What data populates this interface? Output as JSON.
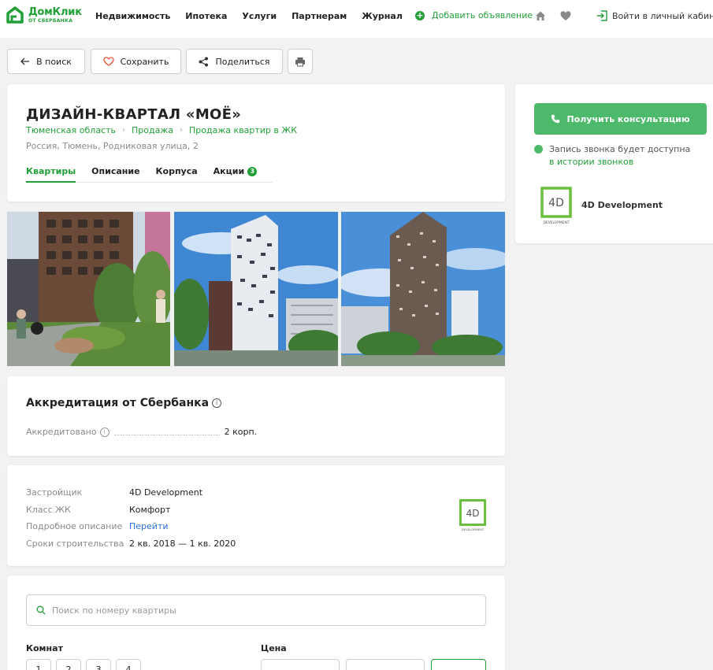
{
  "header": {
    "logo_title": "ДомКлик",
    "logo_sub": "ОТ СБЕРБАНКА",
    "nav": [
      "Недвижимость",
      "Ипотека",
      "Услуги",
      "Партнерам",
      "Журнал"
    ],
    "add_ad": "Добавить объявление",
    "login": "Войти в личный кабинет"
  },
  "actions": {
    "back": "В поиск",
    "save": "Сохранить",
    "share": "Поделиться"
  },
  "complex": {
    "title": "ДИЗАЙН-КВАРТАЛ «МОЁ»",
    "breadcrumbs": [
      "Тюменская область",
      "Продажа",
      "Продажа квартир в ЖК"
    ],
    "address": "Россия, Тюмень, Родниковая улица, 2",
    "tabs": [
      "Квартиры",
      "Описание",
      "Корпуса",
      "Акции"
    ],
    "promo_count": "3"
  },
  "accreditation": {
    "title": "Аккредитация от Сбербанка",
    "label": "Аккредитовано",
    "value": "2 корп.",
    "info_glyph": "i"
  },
  "details": {
    "rows": [
      {
        "k": "Застройщик",
        "v": "4D Development"
      },
      {
        "k": "Класс ЖК",
        "v": "Комфорт"
      },
      {
        "k": "Подробное описание",
        "v": "Перейти"
      },
      {
        "k": "Сроки строительства",
        "v": "2 кв. 2018 — 1 кв. 2020"
      }
    ],
    "logo_text": "4D",
    "logo_sub": "DEVELOPMENT"
  },
  "filters": {
    "search_placeholder": "Поиск по номеру квартиры",
    "rooms_label": "Комнат",
    "price_label": "Цена",
    "rooms": [
      "1",
      "2",
      "3",
      "4"
    ]
  },
  "sidebar": {
    "consult": "Получить консультацию",
    "call_note": "Запись звонка будет доступна",
    "call_link": "в истории звонков",
    "developer": "4D Development"
  },
  "colors": {
    "brand": "#21a038",
    "button_green": "#4dba6b",
    "link_blue": "#2a6fdb"
  }
}
